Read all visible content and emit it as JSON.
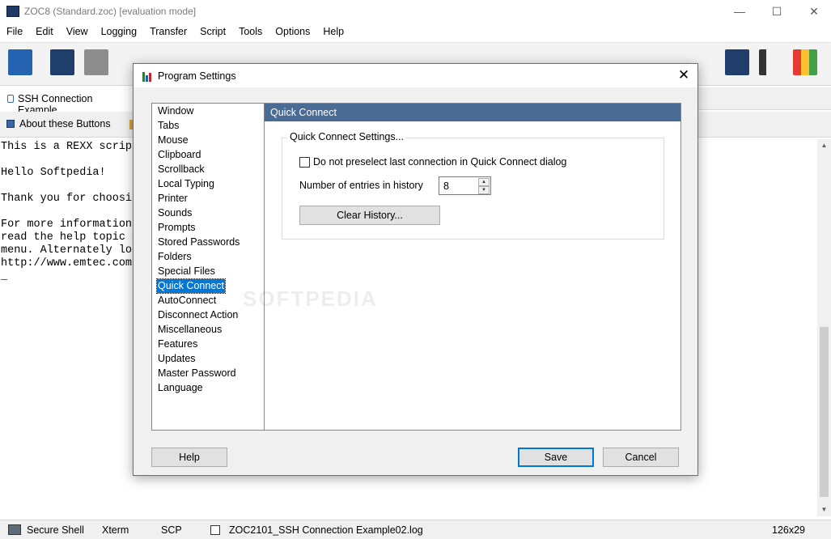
{
  "window": {
    "title": "ZOC8 (Standard.zoc) [evaluation mode]",
    "minimize": "—",
    "maximize": "☐",
    "close": "✕"
  },
  "menu": [
    "File",
    "Edit",
    "View",
    "Logging",
    "Transfer",
    "Script",
    "Tools",
    "Options",
    "Help"
  ],
  "session_tab": "SSH Connection Example",
  "buttons_bar": {
    "about": "About these Buttons"
  },
  "terminal": {
    "lines": [
      "This is a REXX script",
      "",
      "Hello Softpedia!",
      "",
      "Thank you for choosin",
      "",
      "For more information",
      "read the help topic a",
      "menu. Alternately loo",
      "http://www.emtec.com/",
      "_"
    ]
  },
  "status": {
    "secure_shell": "Secure Shell",
    "emulation": "Xterm",
    "transfer": "SCP",
    "logfile": "ZOC2101_SSH Connection Example02.log",
    "size": "126x29"
  },
  "dialog": {
    "title": "Program Settings",
    "close": "✕",
    "nav": [
      "Window",
      "Tabs",
      "Mouse",
      "Clipboard",
      "Scrollback",
      "Local Typing",
      "Printer",
      "Sounds",
      "Prompts",
      "Stored Passwords",
      "Folders",
      "Special Files",
      "Quick Connect",
      "AutoConnect",
      "Disconnect Action",
      "Miscellaneous",
      "Features",
      "Updates",
      "Master Password",
      "Language"
    ],
    "selected_nav": "Quick Connect",
    "panel_title": "Quick Connect",
    "group_title": "Quick Connect Settings...",
    "no_preselect_label": "Do not preselect last connection in Quick Connect dialog",
    "no_preselect_checked": false,
    "history_label": "Number of entries in history",
    "history_value": "8",
    "clear_history": "Clear History...",
    "help": "Help",
    "save": "Save",
    "cancel": "Cancel"
  },
  "watermark": "SOFTPEDIA",
  "colors": {
    "panel_header": "#4a6b94",
    "selection": "#0078d7"
  }
}
